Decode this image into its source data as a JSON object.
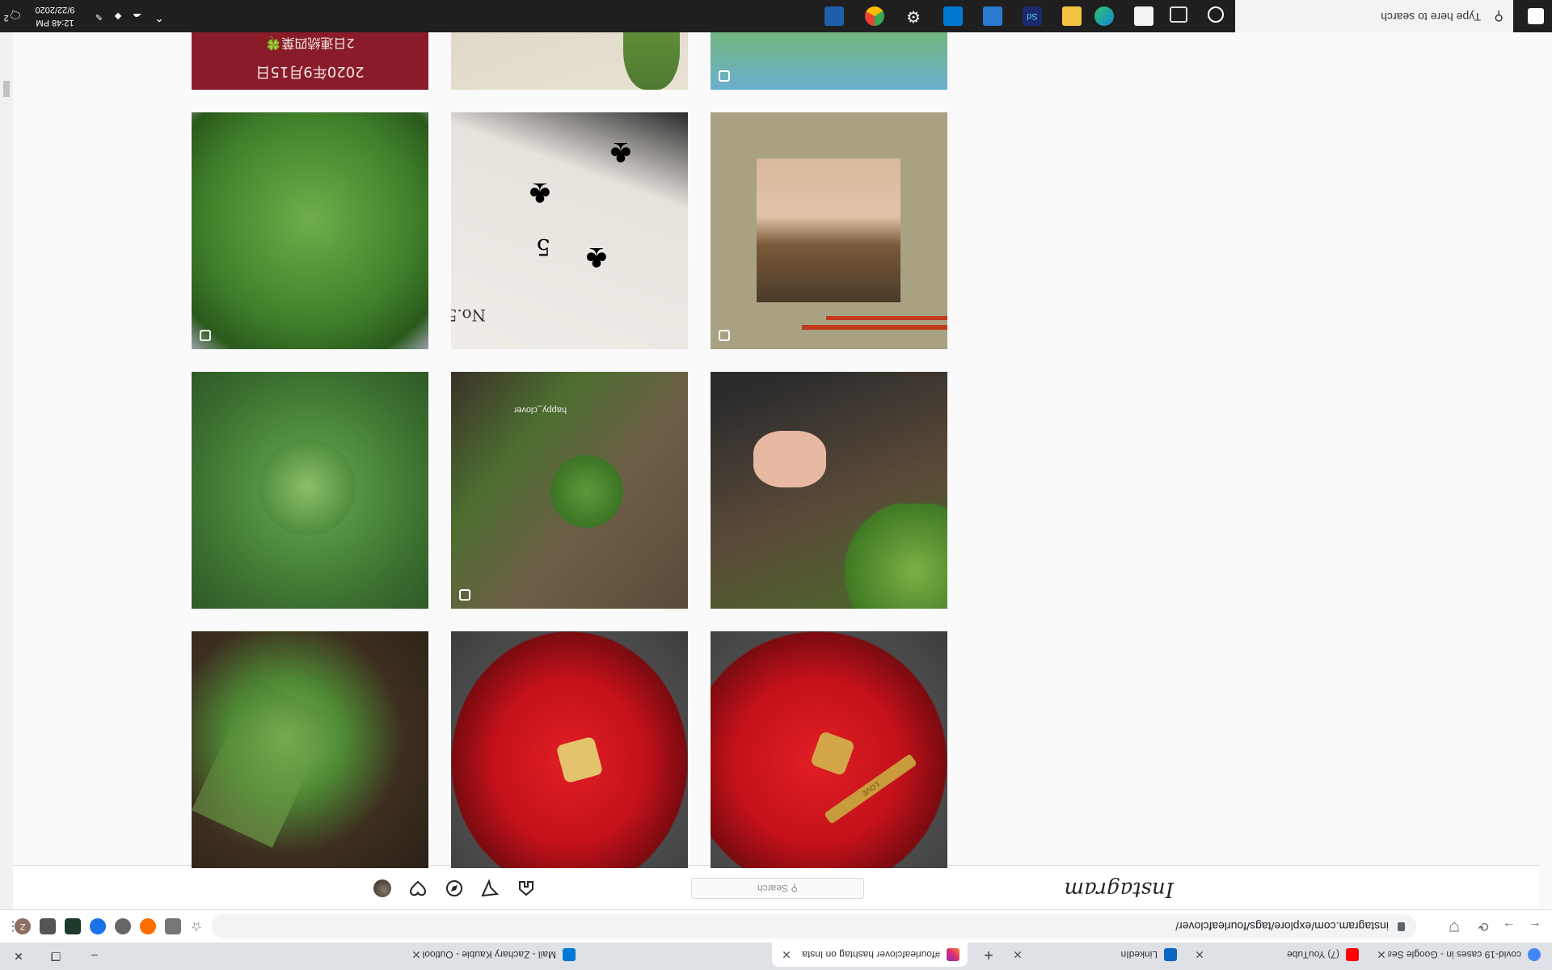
{
  "browser": {
    "tabs": [
      {
        "label": "covid-19 cases in - Google Searc",
        "icon": "google-icon",
        "color": "#4285f4",
        "active": false
      },
      {
        "label": "(7) YouTube",
        "icon": "youtube-icon",
        "color": "#ff0000",
        "active": false
      },
      {
        "label": "LinkedIn",
        "icon": "linkedin-icon",
        "color": "#0a66c2",
        "active": false
      },
      {
        "label": "Mail - Zachary Kauble - Outlook",
        "icon": "outlook-icon",
        "color": "#0078d4",
        "active": false
      },
      {
        "label": "#fourleafclover hashtag on Insta",
        "icon": "instagram-icon",
        "color": "#e1306c",
        "active": true
      }
    ],
    "new_tab_label": "+",
    "window": {
      "minimize": "–",
      "restore": "❐",
      "close": "✕"
    },
    "url": "instagram.com/explore/tags/fourleafclover/",
    "nav": {
      "back": "←",
      "forward": "→",
      "reload": "⟳",
      "star": "☆",
      "menu": "⋮"
    },
    "profile_initial": "Z"
  },
  "instagram": {
    "logo": "Instagram",
    "search_placeholder": "Search",
    "nav_icons": [
      "home-icon",
      "direct-icon",
      "explore-icon",
      "activity-icon",
      "profile-avatar"
    ]
  },
  "grid": {
    "posts": [
      {
        "id": "heart-red-1",
        "multi": false
      },
      {
        "id": "heart-red-2",
        "multi": false
      },
      {
        "id": "clover-grass",
        "multi": false
      },
      {
        "id": "hand-clover-soil",
        "multi": false
      },
      {
        "id": "clover-dry-ground",
        "multi": true
      },
      {
        "id": "clover-patch",
        "multi": false
      },
      {
        "id": "portrait-card",
        "multi": true
      },
      {
        "id": "playing-card-clubs",
        "multi": false
      },
      {
        "id": "clover-bouquet",
        "multi": true
      },
      {
        "id": "clover-cutouts",
        "multi": true
      },
      {
        "id": "fern-pressed",
        "multi": false
      },
      {
        "id": "red-calendar",
        "multi": false
      }
    ],
    "calendar_text": "2020年9月15日",
    "calendar_subtext": "2日連続四葉🍀",
    "card_number": "5",
    "card_no": "No.5",
    "watermark": "happy_clover",
    "pin_text": "LOVE"
  },
  "taskbar": {
    "search_placeholder": "Type here to search",
    "time": "12:48 PM",
    "date": "9/22/2020",
    "notification_count": "2",
    "apps": [
      "cortana-icon",
      "task-view-icon",
      "store-icon",
      "edge-icon",
      "file-explorer-icon",
      "sd-icon",
      "photos-icon",
      "outlook-icon",
      "settings-icon",
      "chrome-icon",
      "paint-icon"
    ]
  },
  "colors": {
    "ig_border": "#dbdbdb",
    "chrome_tab": "#dee1e6",
    "taskbar": "#1f1f1f"
  }
}
